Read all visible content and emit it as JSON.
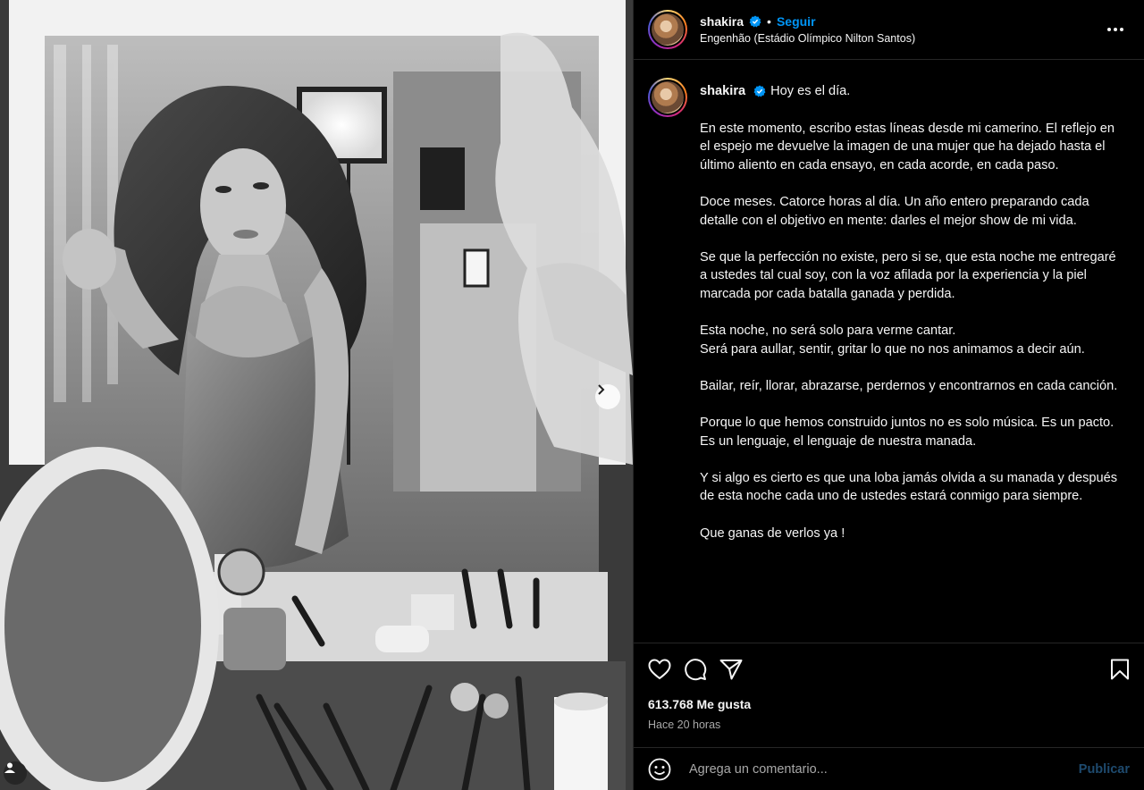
{
  "post": {
    "username": "shakira",
    "follow_label": "Seguir",
    "separator": "•",
    "location": "Engenhão (Estádio Olímpico Nilton Santos)",
    "more_icon": "more-horizontal-icon"
  },
  "caption": {
    "username": "shakira",
    "title": "Hoy es el día.",
    "paragraphs": [
      "En este momento, escribo estas líneas desde mi camerino. El reflejo en el espejo me devuelve la imagen de una mujer que ha dejado hasta el último aliento en cada ensayo, en cada acorde, en cada paso.",
      "Doce meses. Catorce horas al día. Un año entero preparando cada detalle con el objetivo en mente: darles el mejor show de mi vida.",
      "Se que la perfección no existe, pero si se, que esta noche me entregaré a ustedes tal cual soy, con la voz afilada por la experiencia y la piel marcada por cada batalla ganada y perdida.",
      "Esta noche, no será solo para verme cantar.",
      "Será para aullar, sentir, gritar lo que no nos animamos a decir aún.",
      "Bailar, reír, llorar, abrazarse, perdernos y encontrarnos en cada canción.",
      "Porque lo que hemos construido juntos no es solo música. Es un pacto. Es un lenguaje, el lenguaje de nuestra manada.",
      "Y si algo es cierto es que una loba jamás olvida a su manada y después de esta noche cada uno de ustedes estará conmigo para siempre.",
      "Que ganas de verlos ya !"
    ]
  },
  "stats": {
    "likes": "613.768 Me gusta",
    "time": "Hace 20 horas"
  },
  "comment": {
    "placeholder": "Agrega un comentario...",
    "publish_label": "Publicar"
  },
  "colors": {
    "accent": "#0095f6",
    "verified": "#0095f6",
    "background": "#000000",
    "border": "#262626",
    "muted": "#a8a8a8"
  }
}
